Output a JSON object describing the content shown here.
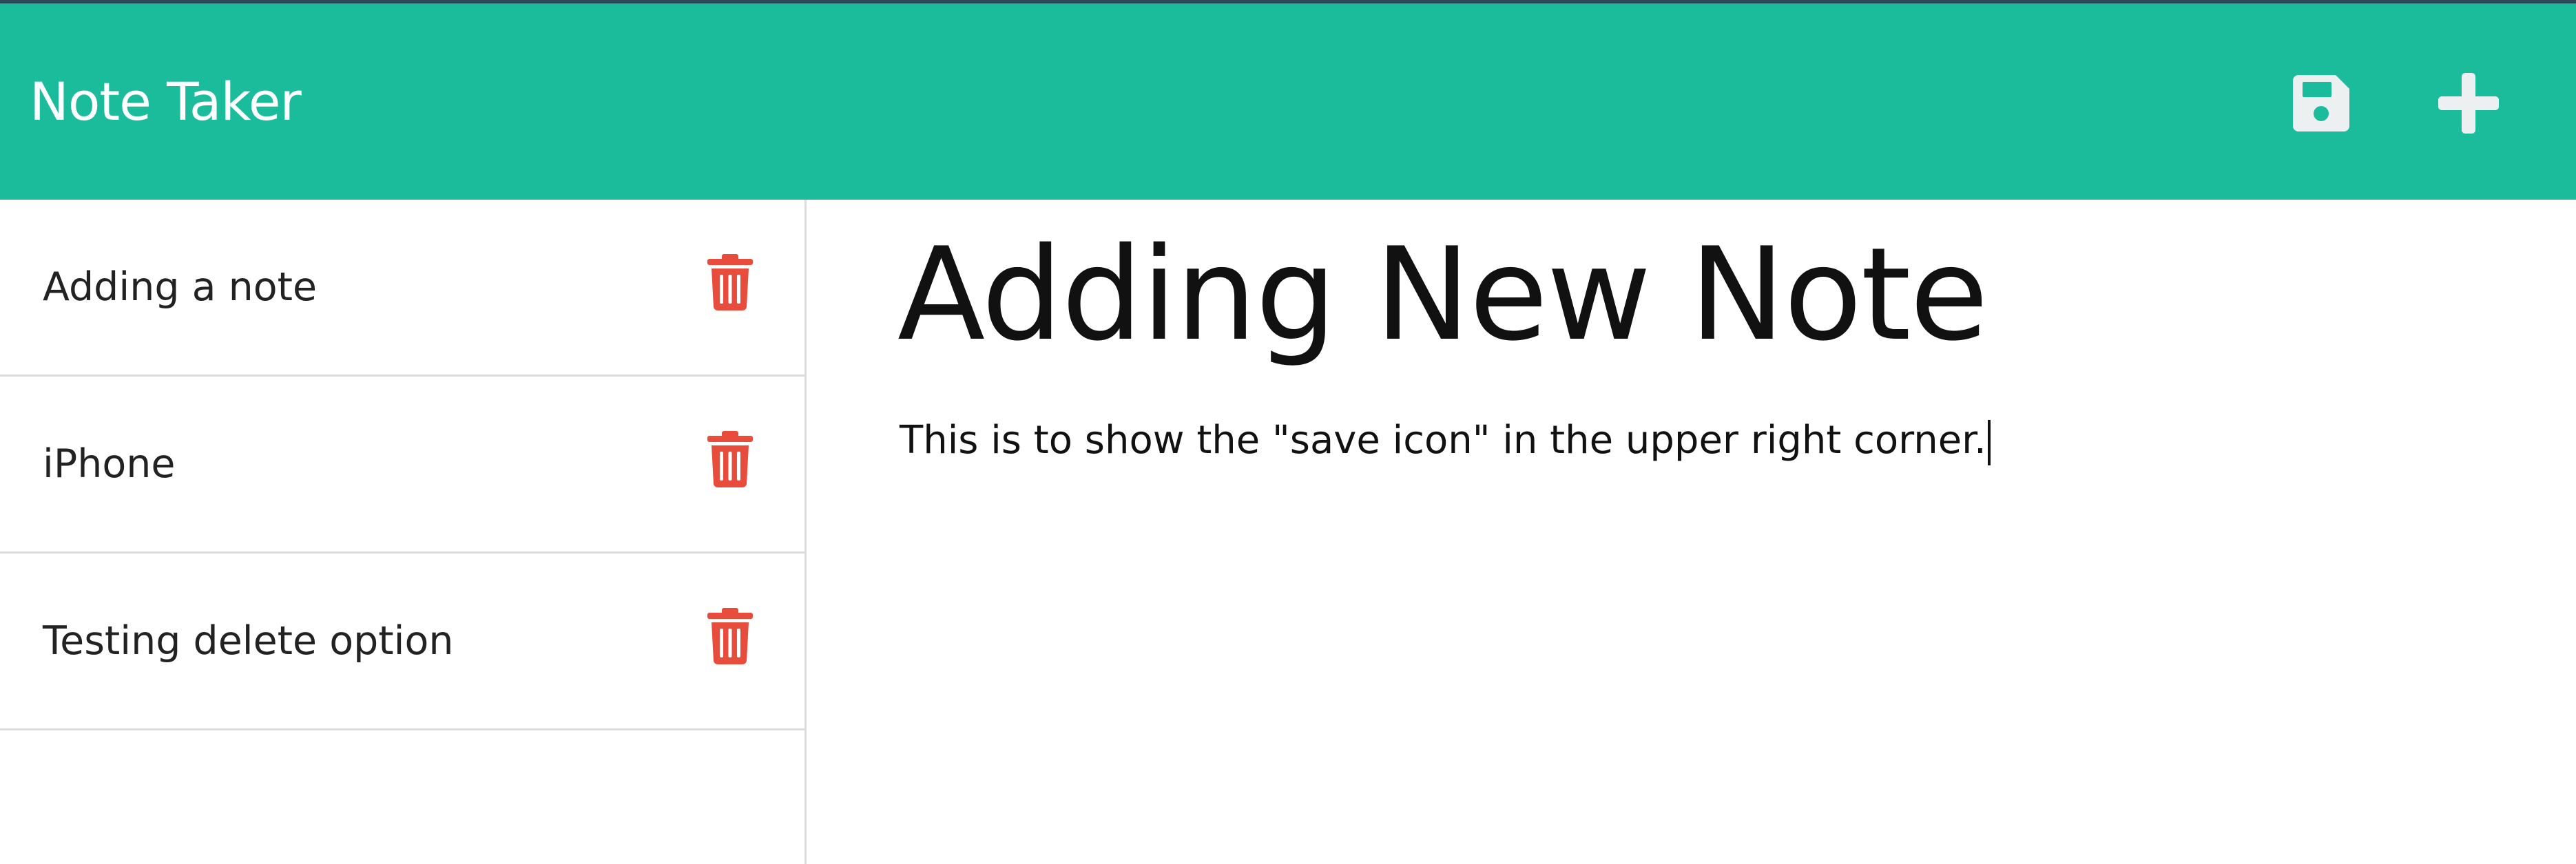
{
  "app": {
    "title": "Note Taker"
  },
  "toolbar": {
    "save_icon": "floppy-disk-icon",
    "add_icon": "plus-icon"
  },
  "sidebar": {
    "notes": [
      {
        "title": "Adding a note",
        "delete_icon": "trash-icon"
      },
      {
        "title": "iPhone",
        "delete_icon": "trash-icon"
      },
      {
        "title": "Testing delete option",
        "delete_icon": "trash-icon"
      }
    ]
  },
  "editor": {
    "title": "Adding New Note",
    "body": "This is to show the \"save icon\" in the upper right corner."
  },
  "colors": {
    "accent": "#1abc9c",
    "danger": "#e74c3c",
    "icon_light": "#ecf0f1"
  }
}
